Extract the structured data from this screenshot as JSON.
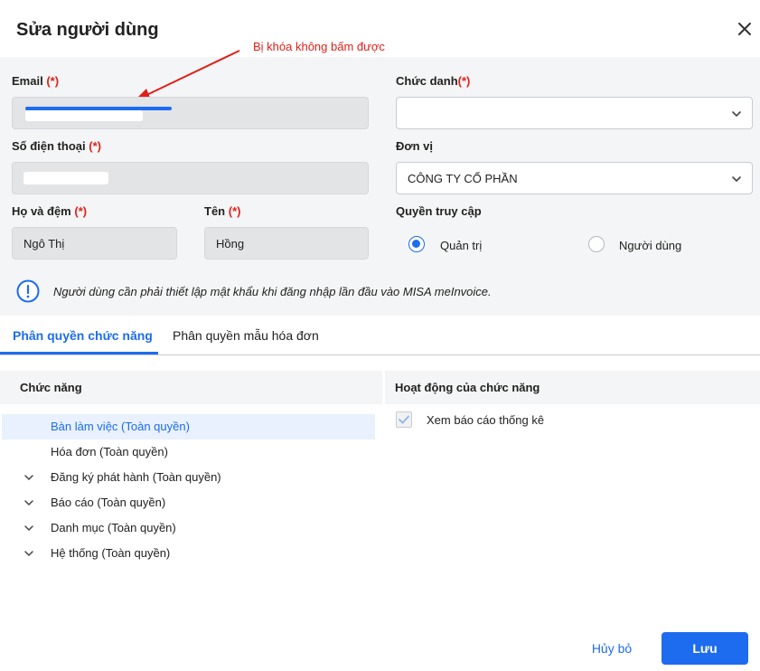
{
  "dialog": {
    "title": "Sửa người dùng"
  },
  "annotation": {
    "text": "Bị khóa không bấm được",
    "color": "#e0201a"
  },
  "form": {
    "email": {
      "label": "Email",
      "required": "(*)"
    },
    "phone": {
      "label": "Số điện thoại",
      "required": "(*)"
    },
    "last_name": {
      "label": "Họ và đệm",
      "required": "(*)",
      "value": "Ngô Thị"
    },
    "first_name": {
      "label": "Tên",
      "required": "(*)",
      "value": "Hồng"
    },
    "job_title": {
      "label": "Chức danh",
      "required": "(*)",
      "value": ""
    },
    "unit": {
      "label": "Đơn vị",
      "value": "CÔNG TY CỔ PHẦN"
    },
    "access": {
      "label": "Quyền truy cập",
      "options": [
        {
          "label": "Quản trị",
          "checked": true
        },
        {
          "label": "Người dùng",
          "checked": false
        }
      ]
    },
    "notice": "Người dùng cần phải thiết lập mật khẩu khi đăng nhập lần đầu vào MISA meInvoice."
  },
  "tabs": [
    {
      "label": "Phân quyền chức năng",
      "active": true
    },
    {
      "label": "Phân quyền mẫu hóa đơn",
      "active": false
    }
  ],
  "functions": {
    "header": "Chức năng",
    "items": [
      {
        "label": "Bàn làm việc (Toàn quyền)",
        "expandable": false,
        "selected": true
      },
      {
        "label": "Hóa đơn (Toàn quyền)",
        "expandable": false,
        "selected": false
      },
      {
        "label": "Đăng ký phát hành (Toàn quyền)",
        "expandable": true,
        "selected": false
      },
      {
        "label": "Báo cáo (Toàn quyền)",
        "expandable": true,
        "selected": false
      },
      {
        "label": "Danh mục (Toàn quyền)",
        "expandable": true,
        "selected": false
      },
      {
        "label": "Hệ thống (Toàn quyền)",
        "expandable": true,
        "selected": false
      }
    ]
  },
  "activities": {
    "header": "Hoạt động của chức năng",
    "items": [
      {
        "label": "Xem báo cáo thống kê",
        "checked": true
      }
    ]
  },
  "footer": {
    "cancel_label": "Hủy bỏ",
    "save_label": "Lưu"
  },
  "colors": {
    "accent": "#1d6cf0",
    "required": "#e0201a",
    "panel_bg": "#f4f5f6"
  }
}
